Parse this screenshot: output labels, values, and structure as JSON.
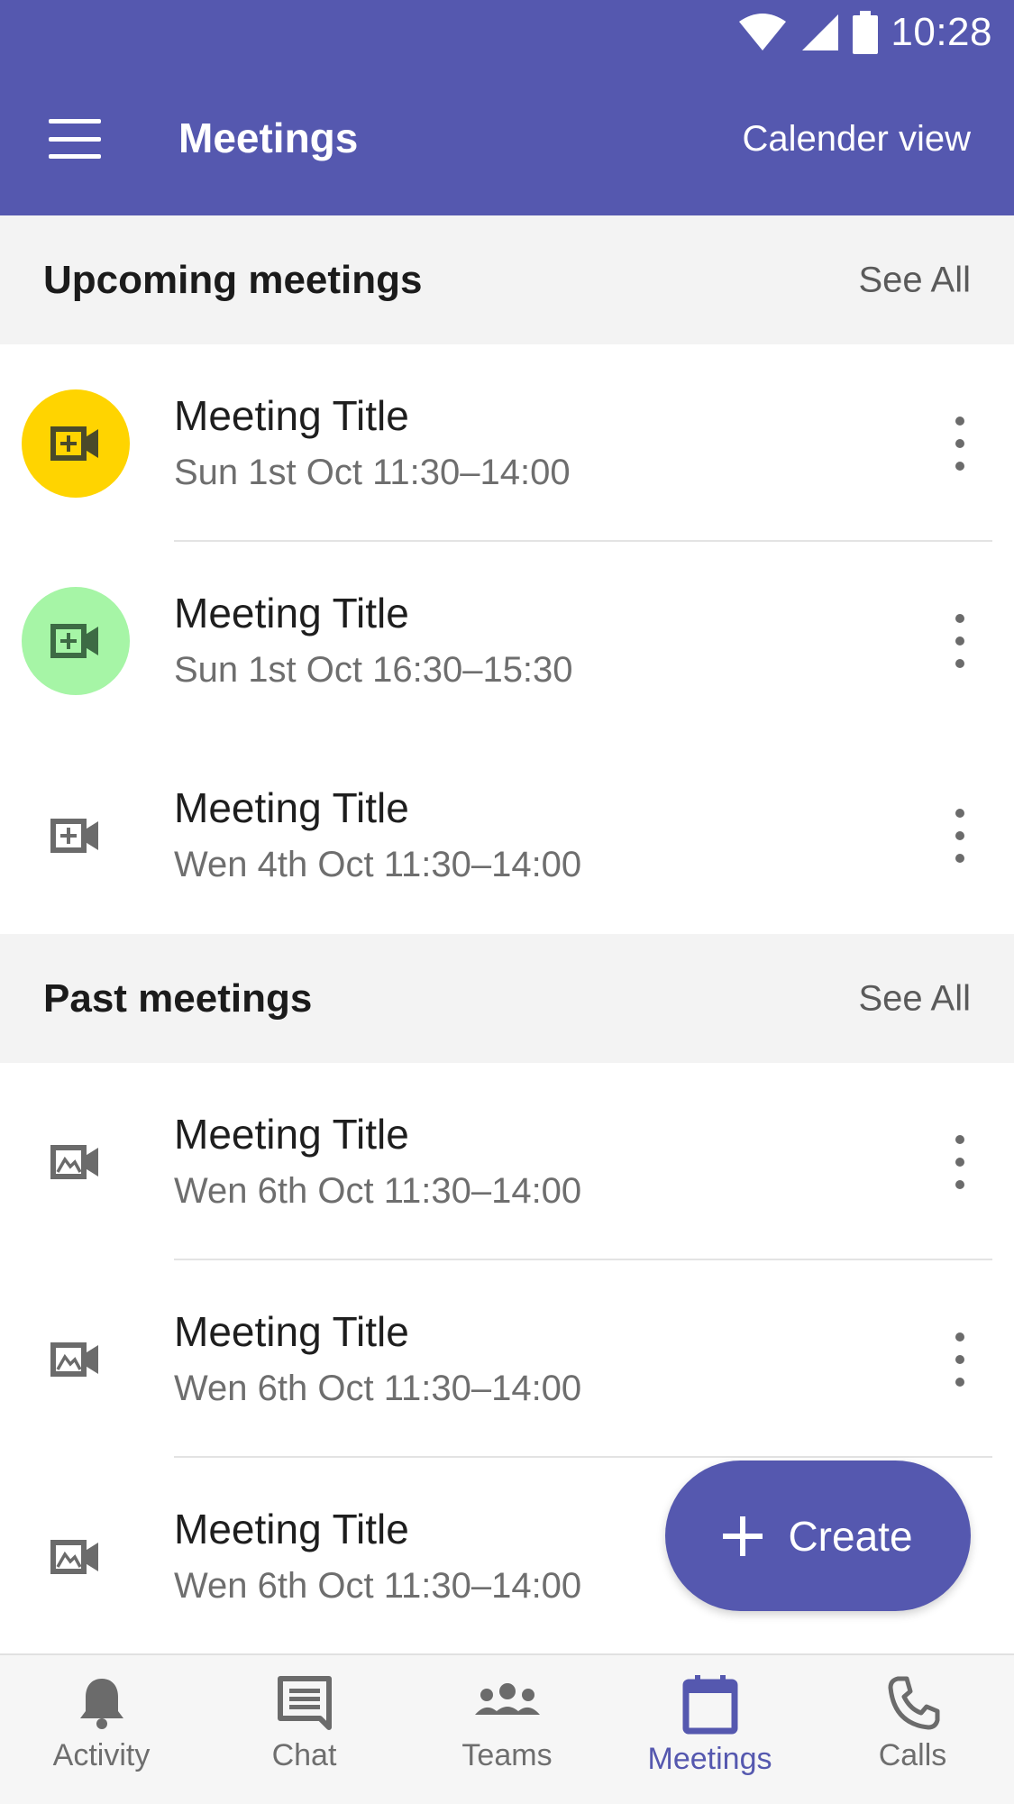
{
  "status_bar": {
    "time": "10:28"
  },
  "app_bar": {
    "title": "Meetings",
    "action": "Calender view"
  },
  "upcoming": {
    "title": "Upcoming meetings",
    "see_all": "See All",
    "items": [
      {
        "title": "Meeting Title",
        "time": "Sun 1st Oct 11:30–14:00",
        "icon": "video-add-icon",
        "accent": "#FFD400"
      },
      {
        "title": "Meeting Title",
        "time": "Sun 1st Oct 16:30–15:30",
        "icon": "video-add-icon",
        "accent": "#A6F5A6"
      },
      {
        "title": "Meeting Title",
        "time": "Wen 4th Oct 11:30–14:00",
        "icon": "video-add-icon",
        "accent": ""
      }
    ]
  },
  "past": {
    "title": "Past meetings",
    "see_all": "See All",
    "items": [
      {
        "title": "Meeting Title",
        "time": "Wen 6th Oct 11:30–14:00",
        "icon": "video-recording-icon"
      },
      {
        "title": "Meeting Title",
        "time": "Wen 6th Oct 11:30–14:00",
        "icon": "video-recording-icon"
      },
      {
        "title": "Meeting Title",
        "time": "Wen 6th Oct 11:30–14:00",
        "icon": "video-recording-icon"
      }
    ]
  },
  "fab": {
    "label": "Create",
    "icon": "plus-icon"
  },
  "nav": [
    {
      "label": "Activity",
      "icon": "bell-icon"
    },
    {
      "label": "Chat",
      "icon": "chat-icon"
    },
    {
      "label": "Teams",
      "icon": "people-icon"
    },
    {
      "label": "Meetings",
      "icon": "calendar-icon",
      "active": true
    },
    {
      "label": "Calls",
      "icon": "phone-icon"
    }
  ],
  "colors": {
    "brand": "#5558AF",
    "section_bg": "#F3F3F3",
    "nav_bg": "#F6F6F6"
  }
}
